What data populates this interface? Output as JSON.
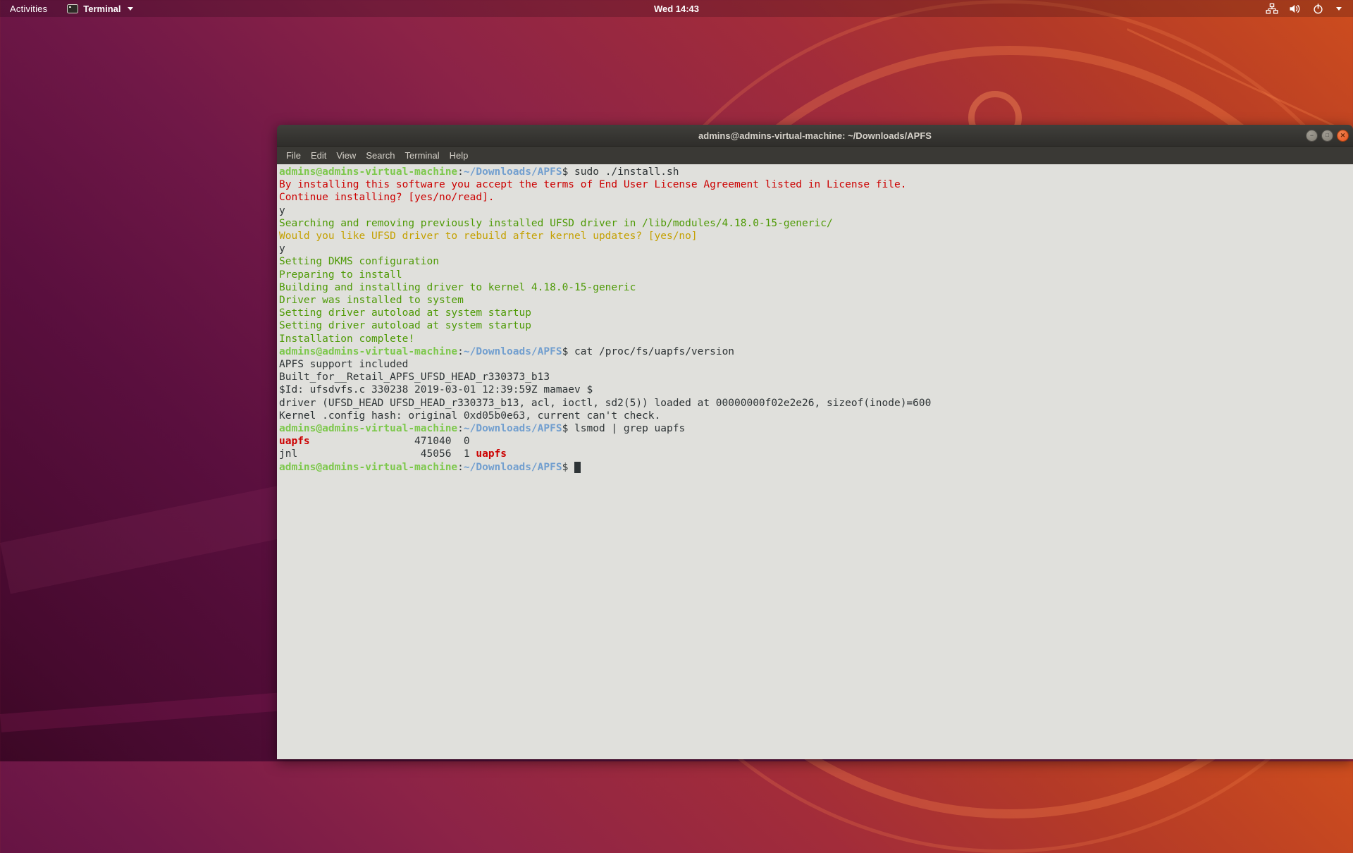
{
  "top_bar": {
    "activities": "Activities",
    "app_name": "Terminal",
    "clock": "Wed 14:43",
    "tray_icons": [
      "network-icon",
      "volume-icon",
      "power-icon",
      "chevron-down-icon"
    ]
  },
  "window": {
    "title": "admins@admins-virtual-machine: ~/Downloads/APFS",
    "menu": [
      "File",
      "Edit",
      "View",
      "Search",
      "Terminal",
      "Help"
    ],
    "controls": [
      {
        "name": "minimize",
        "glyph": "−"
      },
      {
        "name": "maximize",
        "glyph": "□"
      },
      {
        "name": "close",
        "glyph": "✕"
      }
    ]
  },
  "terminal": {
    "palette": {
      "background": "#e0e0dc",
      "foreground": "#2e3436",
      "prompt_user_green": "#7dc84c",
      "path_blue": "#729fcf",
      "error_red": "#cc0000",
      "info_green": "#4e9a06",
      "warn_yellow": "#c4a000",
      "accent_orange": "#e95420"
    },
    "prompt": {
      "user_host": "admins@admins-virtual-machine",
      "path": "~/Downloads/APFS"
    },
    "lines": [
      [
        {
          "s": "u",
          "t": "admins@admins-virtual-machine"
        },
        {
          "s": "d",
          "t": ":"
        },
        {
          "s": "h",
          "t": "~/Downloads/APFS"
        },
        {
          "s": "d",
          "t": "$ sudo ./install.sh"
        }
      ],
      [
        {
          "s": "r",
          "t": "By installing this software you accept the terms of End User License Agreement listed in License file."
        }
      ],
      [
        {
          "s": "r",
          "t": "Continue installing? [yes/no/read]."
        }
      ],
      [
        {
          "s": "d",
          "t": "y"
        }
      ],
      [
        {
          "s": "g",
          "t": "Searching and removing previously installed UFSD driver in /lib/modules/4.18.0-15-generic/"
        }
      ],
      [
        {
          "s": "y",
          "t": "Would you like UFSD driver to rebuild after kernel updates? [yes/no]"
        }
      ],
      [
        {
          "s": "d",
          "t": "y"
        }
      ],
      [
        {
          "s": "g",
          "t": "Setting DKMS configuration"
        }
      ],
      [
        {
          "s": "g",
          "t": "Preparing to install"
        }
      ],
      [
        {
          "s": "g",
          "t": "Building and installing driver to kernel 4.18.0-15-generic"
        }
      ],
      [
        {
          "s": "g",
          "t": "Driver was installed to system"
        }
      ],
      [
        {
          "s": "g",
          "t": "Setting driver autoload at system startup"
        }
      ],
      [
        {
          "s": "g",
          "t": "Setting driver autoload at system startup"
        }
      ],
      [
        {
          "s": "g",
          "t": "Installation complete!"
        }
      ],
      [
        {
          "s": "u",
          "t": "admins@admins-virtual-machine"
        },
        {
          "s": "d",
          "t": ":"
        },
        {
          "s": "h",
          "t": "~/Downloads/APFS"
        },
        {
          "s": "d",
          "t": "$ cat /proc/fs/uapfs/version"
        }
      ],
      [
        {
          "s": "d",
          "t": "APFS support included"
        }
      ],
      [
        {
          "s": "d",
          "t": "Built_for__Retail_APFS_UFSD_HEAD_r330373_b13"
        }
      ],
      [
        {
          "s": "d",
          "t": "$Id: ufsdvfs.c 330238 2019-03-01 12:39:59Z mamaev $"
        }
      ],
      [
        {
          "s": "d",
          "t": "driver (UFSD_HEAD UFSD_HEAD_r330373_b13, acl, ioctl, sd2(5)) loaded at 00000000f02e2e26, sizeof(inode)=600"
        }
      ],
      [
        {
          "s": "d",
          "t": "Kernel .config hash: original 0xd05b0e63, current can't check."
        }
      ],
      [
        {
          "s": "u",
          "t": "admins@admins-virtual-machine"
        },
        {
          "s": "d",
          "t": ":"
        },
        {
          "s": "h",
          "t": "~/Downloads/APFS"
        },
        {
          "s": "d",
          "t": "$ lsmod | grep uapfs"
        }
      ],
      [
        {
          "s": "rb",
          "t": "uapfs"
        },
        {
          "s": "d",
          "t": "                 471040  0"
        }
      ],
      [
        {
          "s": "d",
          "t": "jnl                    45056  1 "
        },
        {
          "s": "rb",
          "t": "uapfs"
        }
      ],
      [
        {
          "s": "u",
          "t": "admins@admins-virtual-machine"
        },
        {
          "s": "d",
          "t": ":"
        },
        {
          "s": "h",
          "t": "~/Downloads/APFS"
        },
        {
          "s": "d",
          "t": "$ "
        },
        {
          "s": "cur",
          "t": " "
        }
      ]
    ]
  }
}
